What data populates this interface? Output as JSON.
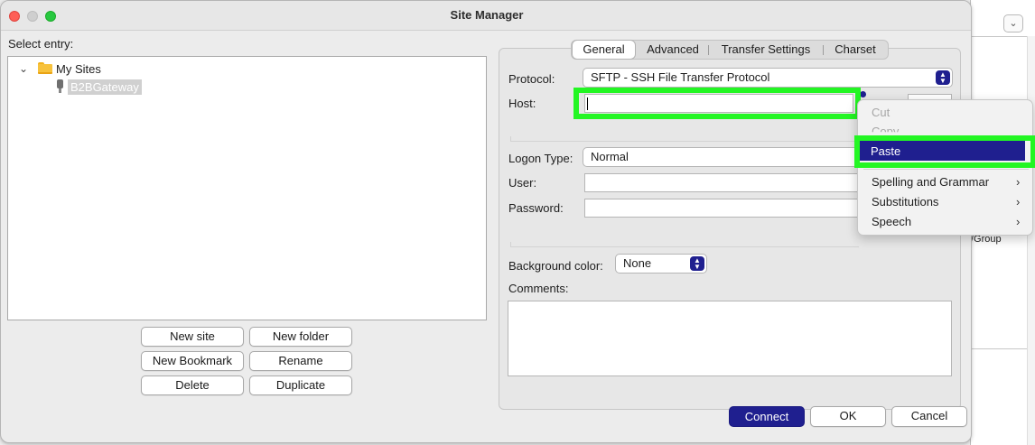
{
  "window": {
    "title": "Site Manager"
  },
  "tree": {
    "label": "Select entry:",
    "root": {
      "label": "My Sites",
      "expanded": true
    },
    "children": [
      {
        "label": "B2BGateway",
        "selected": true
      }
    ]
  },
  "buttons": {
    "new_site": "New site",
    "new_folder": "New folder",
    "new_bookmark": "New Bookmark",
    "rename": "Rename",
    "delete": "Delete",
    "duplicate": "Duplicate",
    "connect": "Connect",
    "ok": "OK",
    "cancel": "Cancel"
  },
  "tabs": [
    {
      "label": "General",
      "active": true
    },
    {
      "label": "Advanced"
    },
    {
      "label": "Transfer Settings"
    },
    {
      "label": "Charset"
    }
  ],
  "form": {
    "protocol_label": "Protocol:",
    "protocol_value": "SFTP - SSH File Transfer Protocol",
    "host_label": "Host:",
    "host_value": "",
    "logon_type_label": "Logon Type:",
    "logon_type_value": "Normal",
    "user_label": "User:",
    "user_value": "",
    "password_label": "Password:",
    "password_value": "",
    "background_color_label": "Background color:",
    "background_color_value": "None",
    "comments_label": "Comments:",
    "comments_value": ""
  },
  "context_menu": {
    "items": [
      {
        "label": "Cut",
        "enabled": false
      },
      {
        "label": "Copy",
        "enabled": false
      },
      {
        "label": "Paste",
        "enabled": true,
        "highlighted": true
      },
      {
        "label": "Spelling and Grammar",
        "submenu": true
      },
      {
        "label": "Substitutions",
        "submenu": true
      },
      {
        "label": "Speech",
        "submenu": true
      }
    ]
  },
  "background_window": {
    "column_header": "/Group"
  },
  "colors": {
    "accent": "#1f1f8f",
    "annotation_highlight": "#23f623",
    "close": "#fe5f57",
    "maximize": "#28c840"
  }
}
